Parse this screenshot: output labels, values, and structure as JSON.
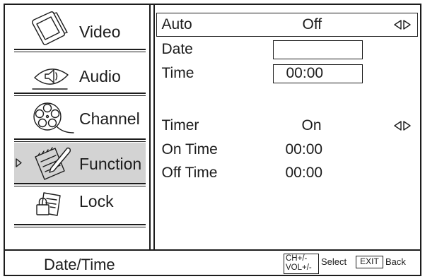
{
  "colors": {
    "background": "#ffffff",
    "line": "#1c1c1c",
    "text": "#1c1c1c",
    "selected_bg": "#d3d3d3"
  },
  "sidebar": {
    "items": [
      {
        "label": "Video",
        "icon": "tv-icon",
        "selected": false
      },
      {
        "label": "Audio",
        "icon": "speaker-icon",
        "selected": false
      },
      {
        "label": "Channel",
        "icon": "film-reel-icon",
        "selected": false
      },
      {
        "label": "Function",
        "icon": "notepad-pencil-icon",
        "selected": true
      },
      {
        "label": "Lock",
        "icon": "lock-icon",
        "selected": false
      }
    ],
    "selected_indicator_icon": "triangle-right-icon"
  },
  "settings": {
    "auto": {
      "label": "Auto",
      "value": "Off",
      "highlighted": true,
      "selector_icon": "left-right-arrows-icon"
    },
    "date": {
      "label": "Date",
      "value": ""
    },
    "time": {
      "label": "Time",
      "value": "00:00"
    },
    "timer": {
      "label": "Timer",
      "value": "On",
      "selector_icon": "left-right-arrows-icon"
    },
    "on_time": {
      "label": "On Time",
      "value": "00:00"
    },
    "off_time": {
      "label": "Off Time",
      "value": "00:00"
    }
  },
  "footer": {
    "title": "Date/Time",
    "select_keys": [
      "CH+/-",
      "VOL+/-"
    ],
    "select_label": "Select",
    "back_key": "EXIT",
    "back_label": "Back"
  }
}
